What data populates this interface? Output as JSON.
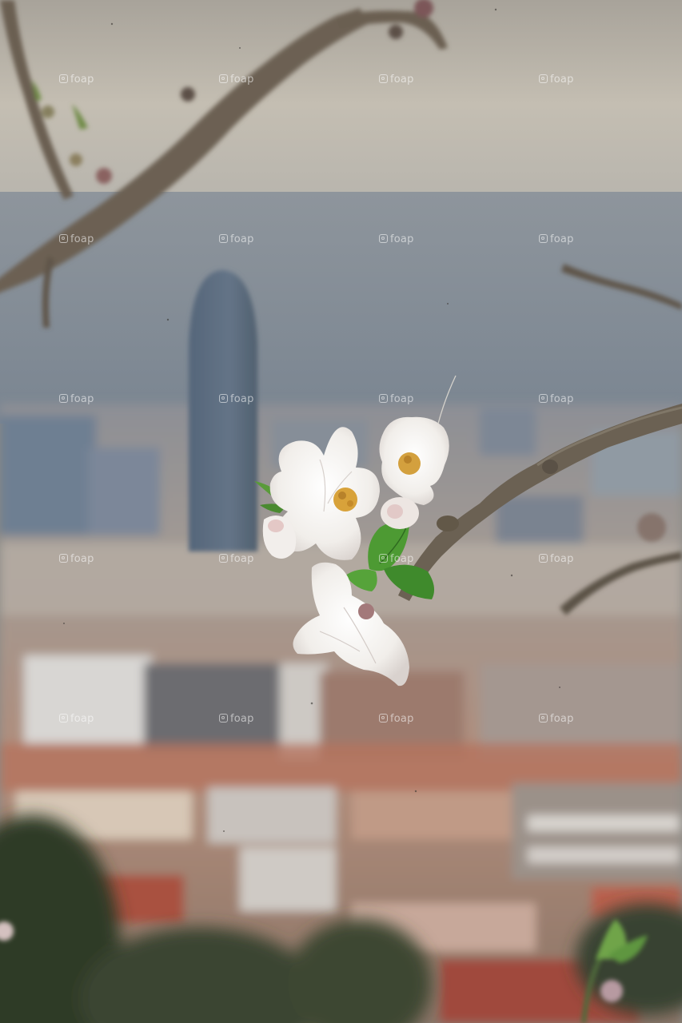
{
  "photo": {
    "subject": "almond-blossom-branch",
    "background": "city-skyline-with-tower",
    "colors": {
      "sky": "#bdb7ac",
      "sea": "#7f8a96",
      "tower": "#5b6b7c",
      "city_warm": "#b3856f",
      "blossom": "#f4f1ee",
      "stamen": "#d8a23a",
      "leaf": "#4f9a35",
      "branch": "#6f6254"
    }
  },
  "watermark": {
    "text": "foap",
    "icon": "camera-icon"
  }
}
